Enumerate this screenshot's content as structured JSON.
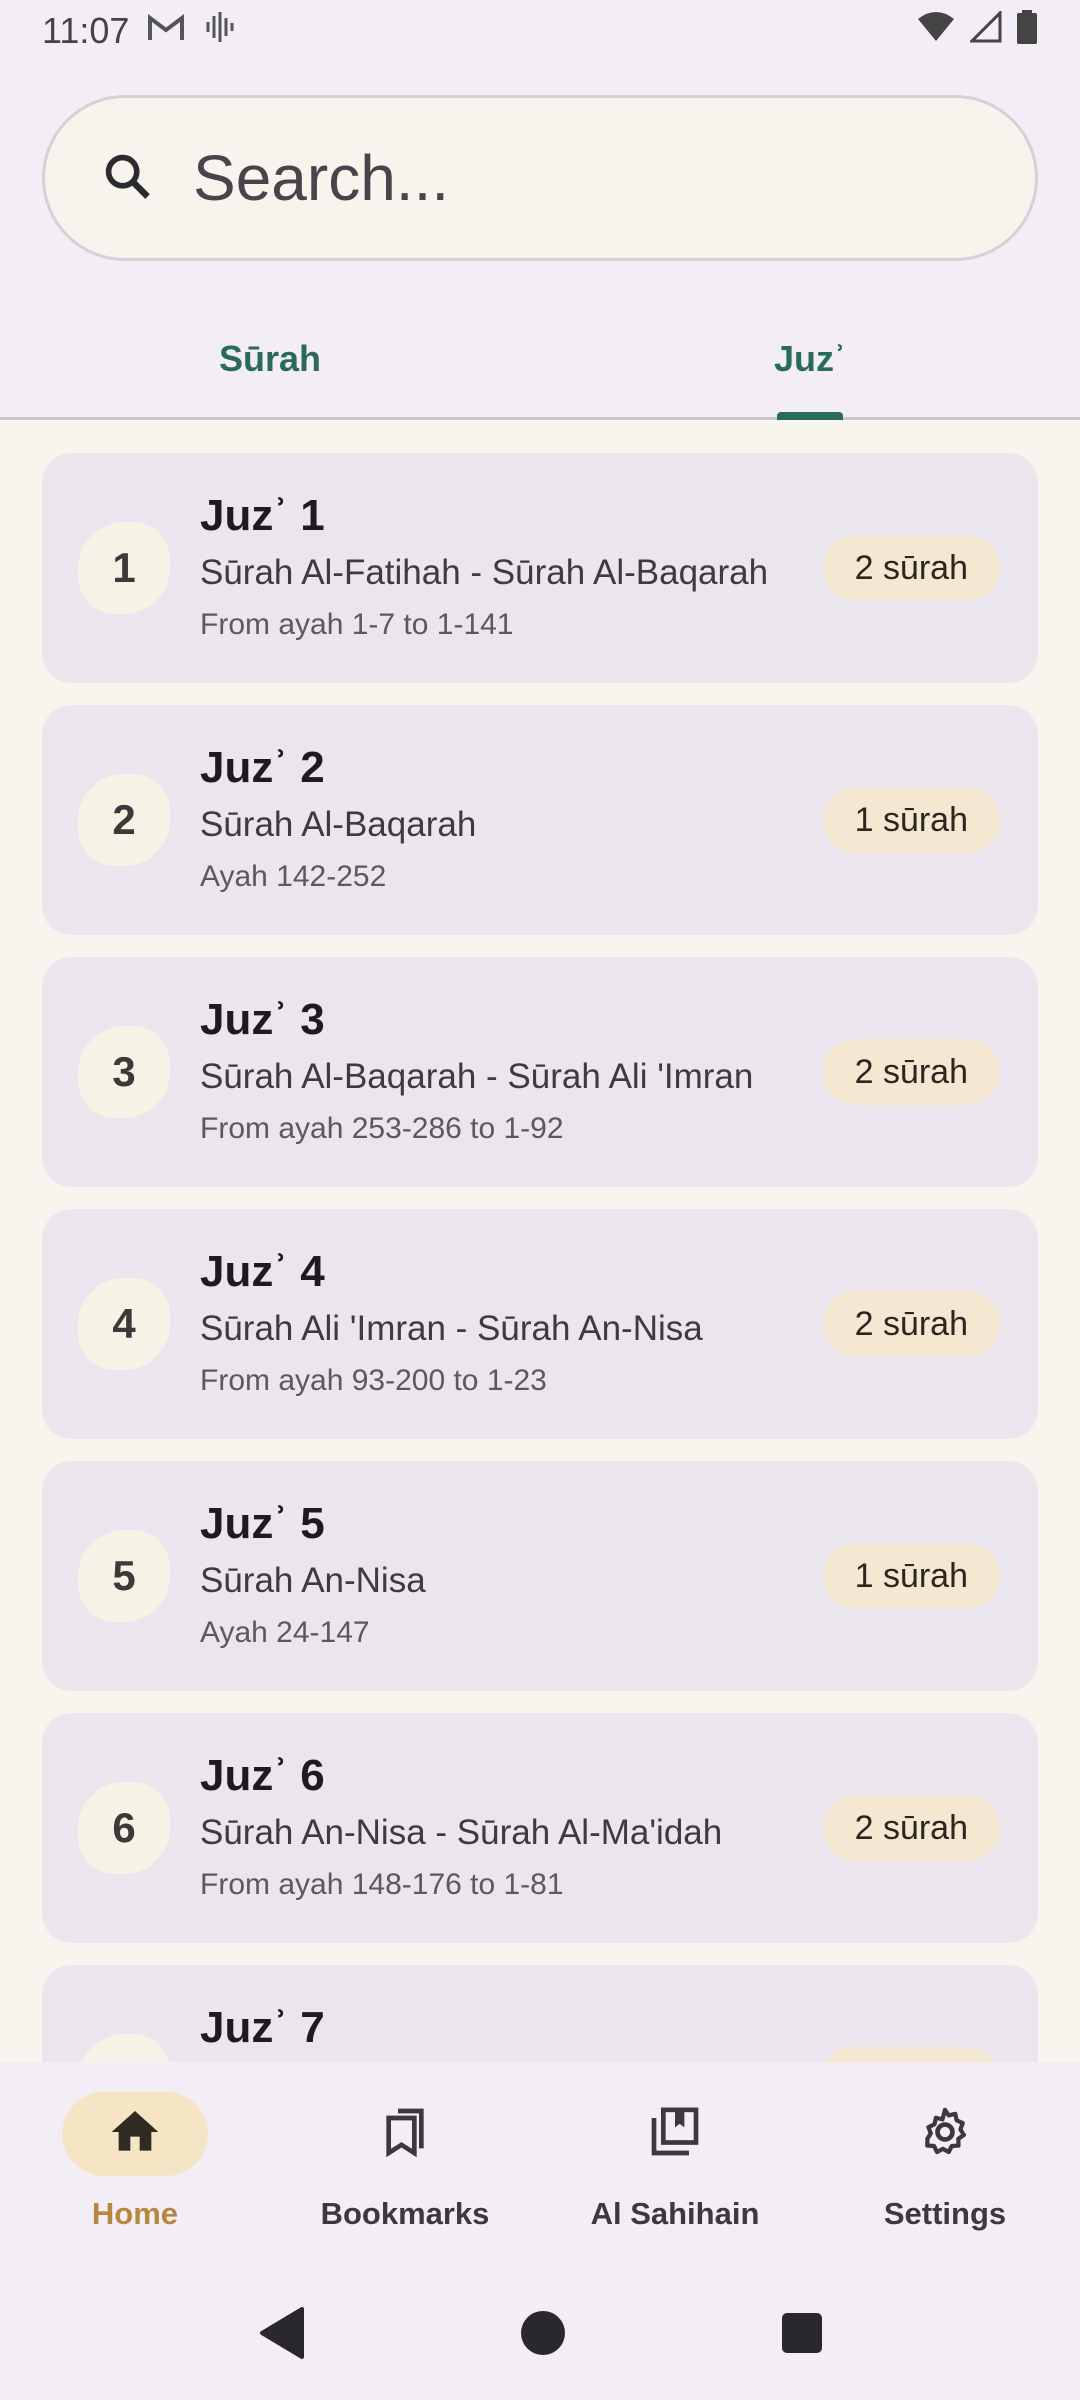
{
  "status_bar": {
    "time": "11:07"
  },
  "search": {
    "placeholder": "Search..."
  },
  "tabs": [
    {
      "label": "Sūrah",
      "active": false
    },
    {
      "label": "Juzʾ",
      "active": true
    }
  ],
  "juz_list": [
    {
      "number": "1",
      "title": "Juzʾ 1",
      "surahs": "Sūrah Al-Fatihah - Sūrah Al-Baqarah",
      "range": "From ayah 1-7 to 1-141",
      "count": "2 sūrah"
    },
    {
      "number": "2",
      "title": "Juzʾ 2",
      "surahs": "Sūrah Al-Baqarah",
      "range": "Ayah 142-252",
      "count": "1 sūrah"
    },
    {
      "number": "3",
      "title": "Juzʾ 3",
      "surahs": "Sūrah Al-Baqarah - Sūrah Ali 'Imran",
      "range": "From ayah 253-286 to 1-92",
      "count": "2 sūrah"
    },
    {
      "number": "4",
      "title": "Juzʾ 4",
      "surahs": "Sūrah Ali 'Imran - Sūrah An-Nisa",
      "range": "From ayah 93-200 to 1-23",
      "count": "2 sūrah"
    },
    {
      "number": "5",
      "title": "Juzʾ 5",
      "surahs": "Sūrah An-Nisa",
      "range": "Ayah 24-147",
      "count": "1 sūrah"
    },
    {
      "number": "6",
      "title": "Juzʾ 6",
      "surahs": "Sūrah An-Nisa - Sūrah Al-Ma'idah",
      "range": "From ayah 148-176 to 1-81",
      "count": "2 sūrah"
    },
    {
      "number": "",
      "title": "Juzʾ 7",
      "surahs": "",
      "range": "",
      "count": ""
    }
  ],
  "bottom_nav": [
    {
      "label": "Home",
      "icon": "home-icon",
      "active": true
    },
    {
      "label": "Bookmarks",
      "icon": "bookmarks-icon",
      "active": false
    },
    {
      "label": "Al Sahihain",
      "icon": "library-icon",
      "active": false
    },
    {
      "label": "Settings",
      "icon": "gear-icon",
      "active": false
    }
  ],
  "colors": {
    "accent_green": "#2a6b58",
    "active_nav_gold": "#b6883d",
    "chip_background": "#f5e8d2",
    "card_background": "#ebe5ee"
  }
}
